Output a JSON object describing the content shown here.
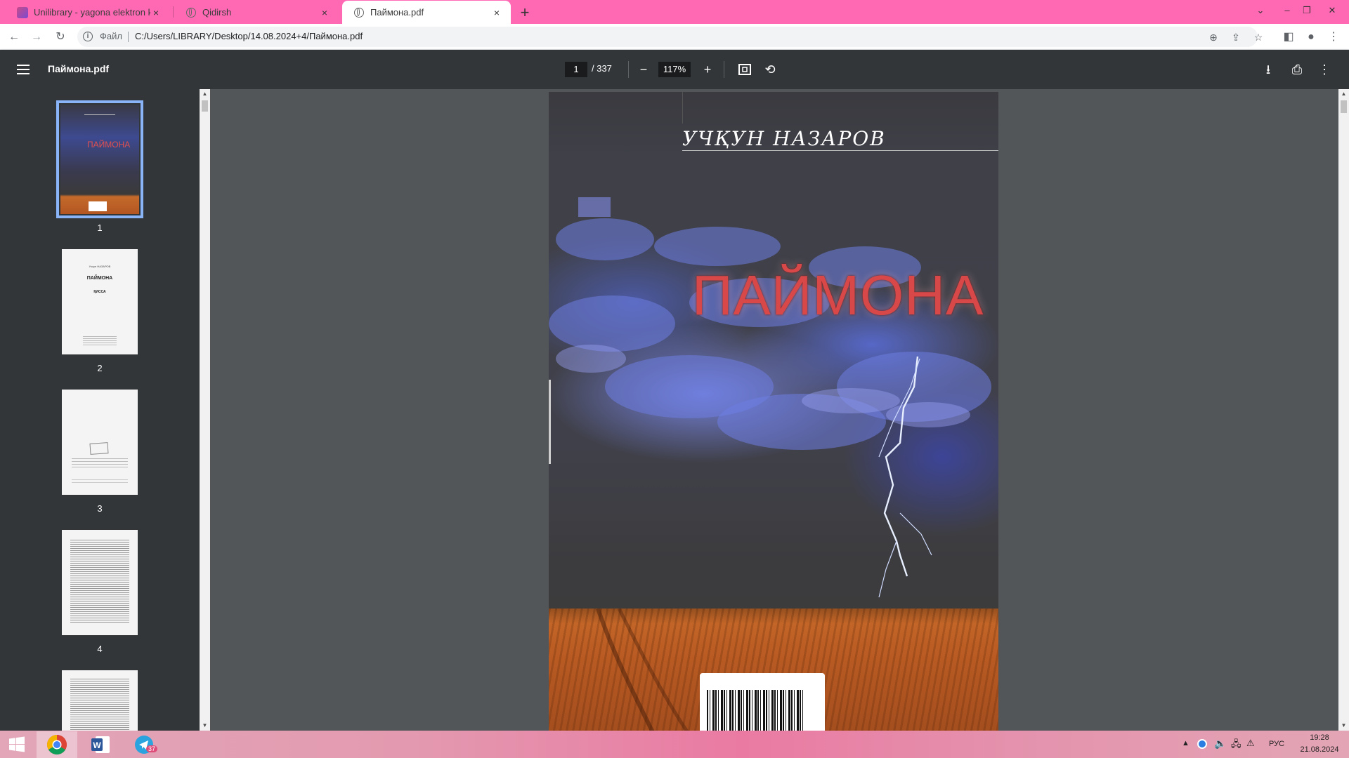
{
  "browser": {
    "tabs": [
      {
        "title": "Unilibrary - yagona elektron kutubxona",
        "close": "×"
      },
      {
        "title": "Qidirsh",
        "close": "×"
      },
      {
        "title": "Паймона.pdf",
        "close": "×"
      }
    ],
    "new_tab": "+",
    "address": {
      "scheme_label": "Файл",
      "url": "C:/Users/LIBRARY/Desktop/14.08.2024+4/Паймона.pdf"
    }
  },
  "pdf_toolbar": {
    "filename": "Паймона.pdf",
    "current_page": "1",
    "total_pages": "/ 337",
    "zoom": "117%"
  },
  "thumbnails": [
    {
      "label": "1",
      "selected": true
    },
    {
      "label": "2",
      "selected": false
    },
    {
      "label": "3",
      "selected": false
    },
    {
      "label": "4",
      "selected": false
    },
    {
      "label": "",
      "selected": false
    }
  ],
  "cover": {
    "author": "УЧҚУН НАЗАРОВ",
    "title": "ПАЙМОНА"
  },
  "thumb2": {
    "author": "Учкун НАЗАРОВ",
    "title": "ПАЙМОНА",
    "genre": "ҚИССА"
  },
  "taskbar": {
    "telegram_badge": "37",
    "language": "РУС",
    "time": "19:28",
    "date": "21.08.2024"
  },
  "colors": {
    "tab_strip": "#ff69b4",
    "pdf_toolbar": "#323639",
    "viewer_bg": "#525659",
    "cover_title": "#d94848",
    "thumb_selected": "#8ab4f8"
  }
}
